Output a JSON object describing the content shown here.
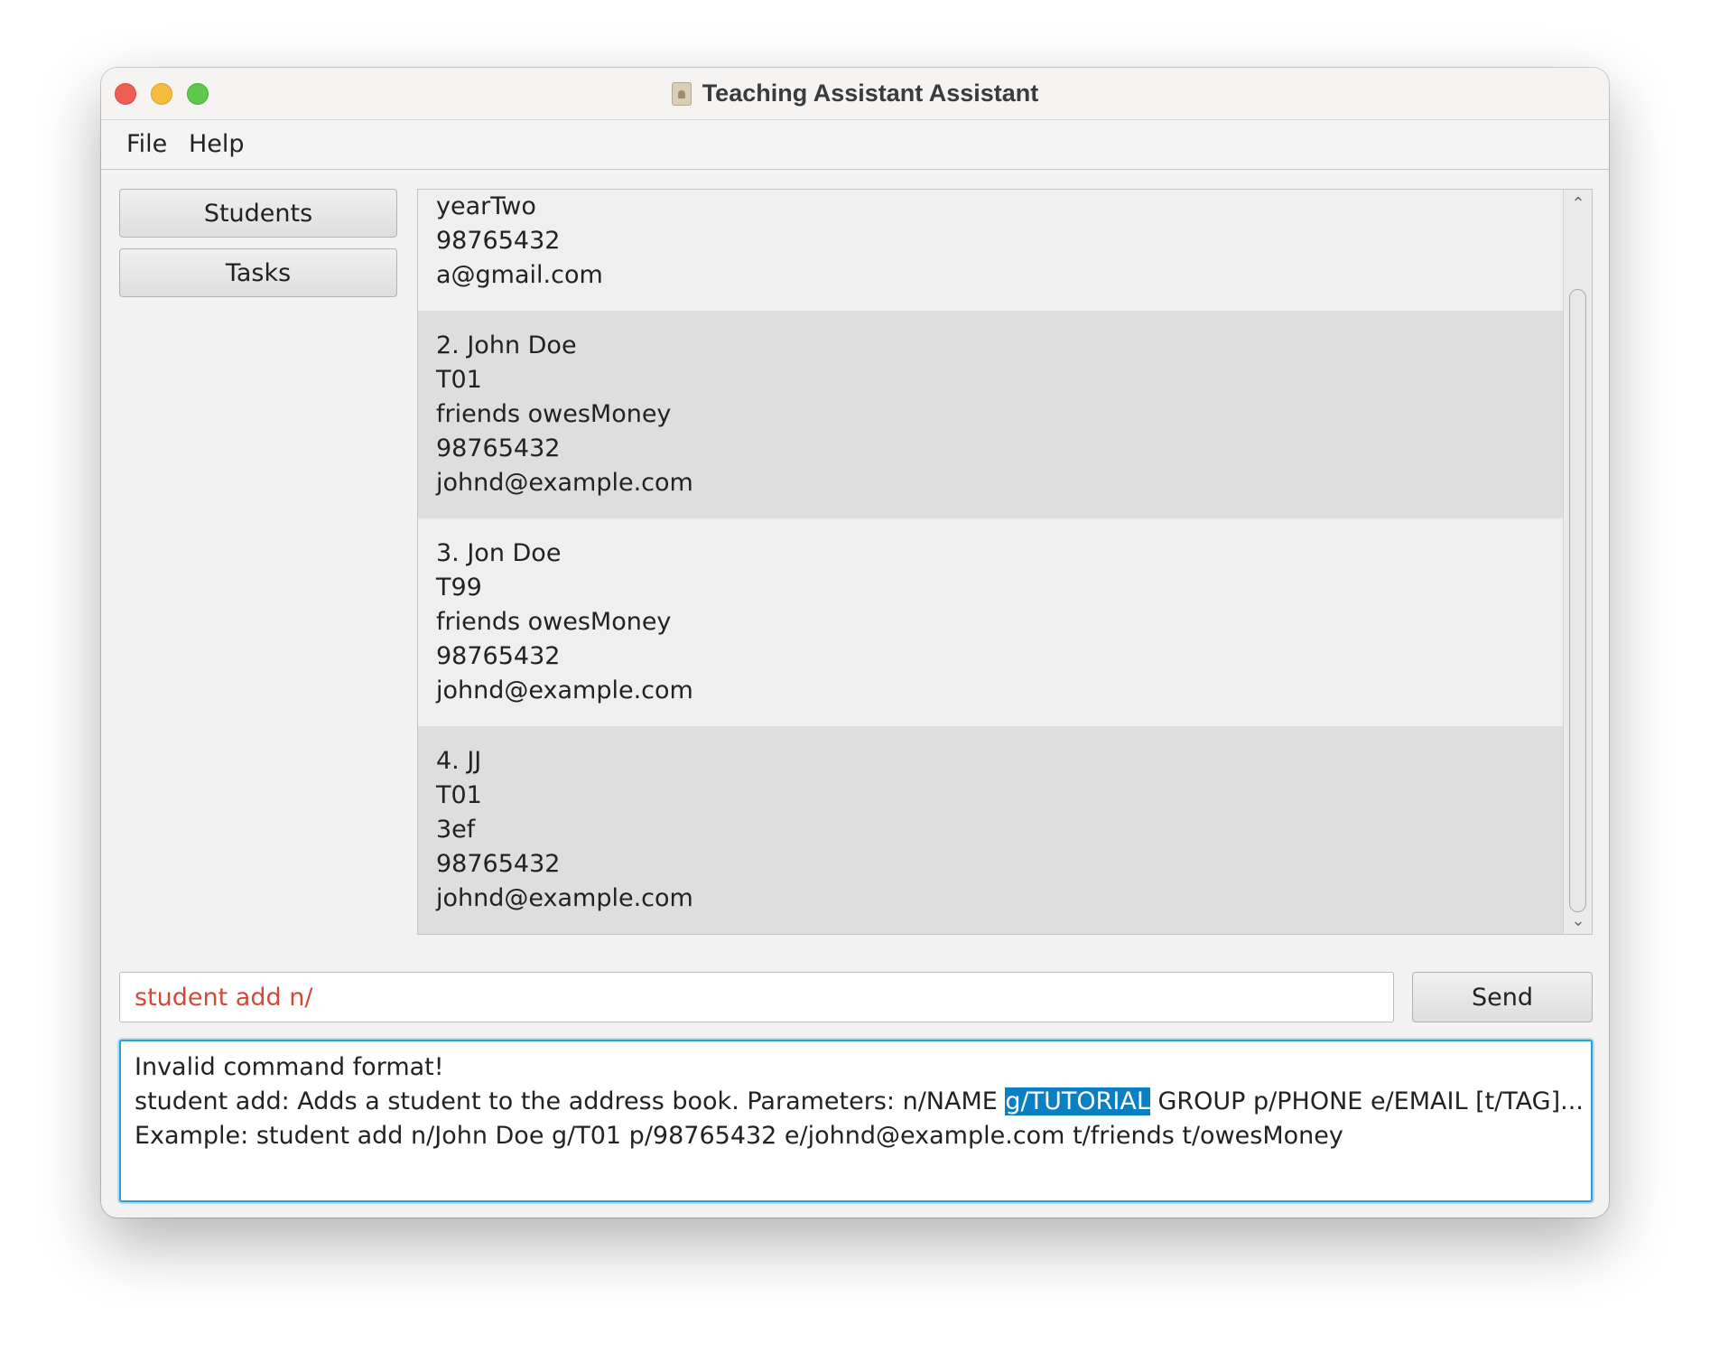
{
  "window": {
    "title": "Teaching Assistant Assistant"
  },
  "menu": {
    "file": "File",
    "help": "Help"
  },
  "sidebar": {
    "students": "Students",
    "tasks": "Tasks"
  },
  "students": [
    {
      "lines": [
        "yearTwo",
        "98765432",
        "a@gmail.com"
      ]
    },
    {
      "lines": [
        "2. John Doe",
        "T01",
        "friends owesMoney",
        "98765432",
        "johnd@example.com"
      ]
    },
    {
      "lines": [
        "3. Jon Doe",
        "T99",
        "friends owesMoney",
        "98765432",
        "johnd@example.com"
      ]
    },
    {
      "lines": [
        "4. JJ",
        "T01",
        "3ef",
        "98765432",
        "johnd@example.com"
      ]
    }
  ],
  "command": {
    "value": "student add n/",
    "send_label": "Send"
  },
  "result": {
    "line1": "Invalid command format!",
    "line2_before": "student add: Adds a student to the address book. Parameters: n/NAME ",
    "line2_highlight": "g/TUTORIAL",
    "line2_after": " GROUP p/PHONE e/EMAIL [t/TAG]...",
    "line3": "Example: student add n/John Doe g/T01 p/98765432 e/johnd@example.com t/friends t/owesMoney"
  },
  "colors": {
    "accent": "#2a9fd8",
    "selection": "#0a7fc2",
    "command_text": "#d04a37"
  }
}
